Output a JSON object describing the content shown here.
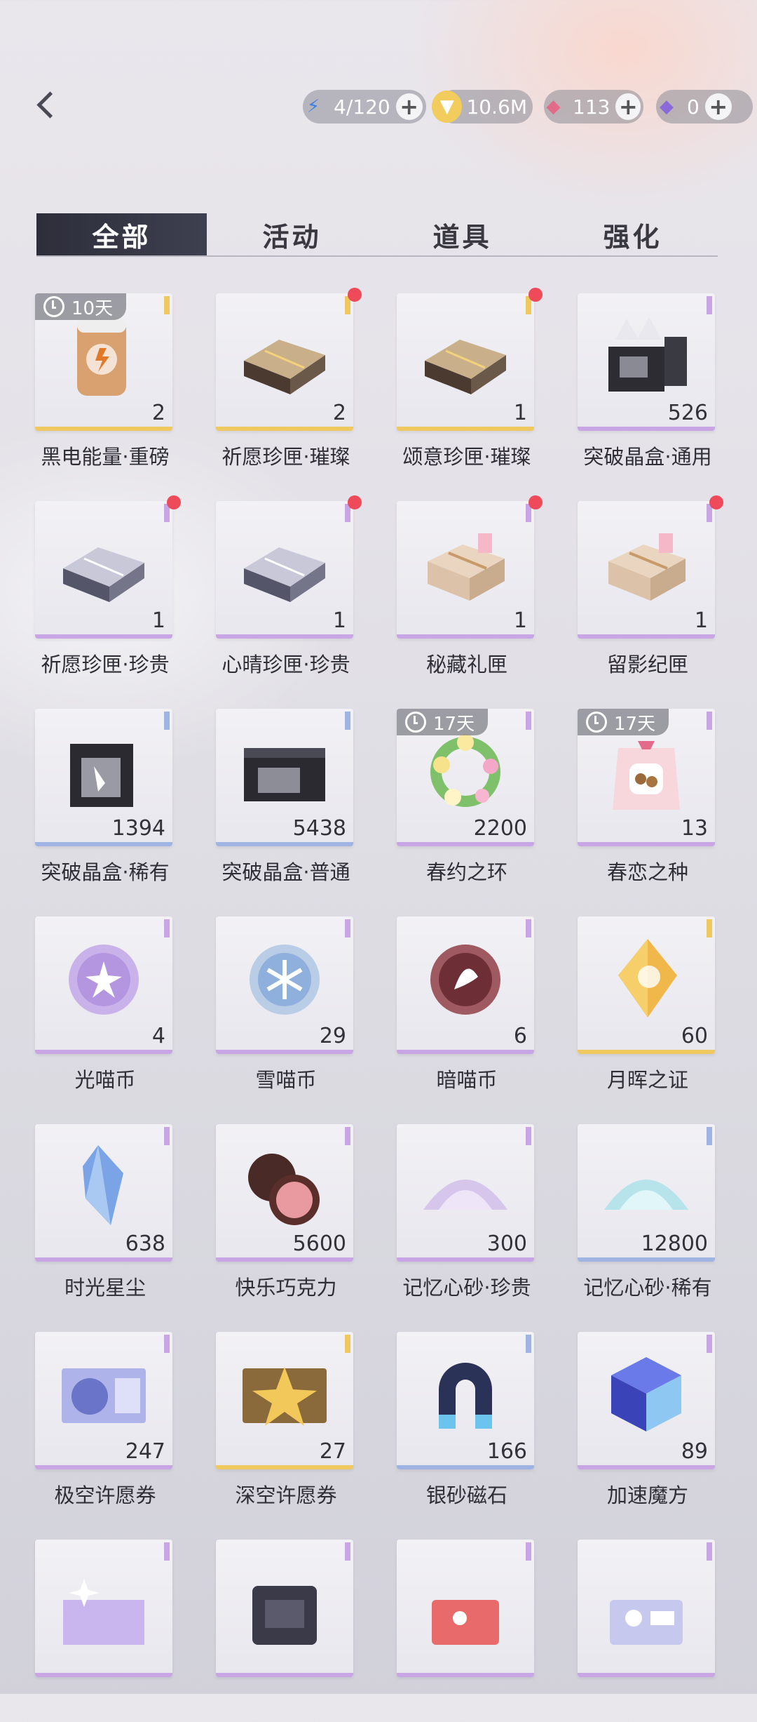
{
  "header": {
    "back_label": "",
    "resources": [
      {
        "icon": "energy-icon",
        "value": "4/120",
        "plus": "+"
      },
      {
        "icon": "gold-coin-icon",
        "value": "10.6M",
        "plus": ""
      },
      {
        "icon": "red-diamond-icon",
        "value": "113",
        "plus": "+"
      },
      {
        "icon": "purple-diamond-icon",
        "value": "0",
        "plus": "+"
      }
    ]
  },
  "tabs": [
    {
      "label": "全部",
      "active": true
    },
    {
      "label": "活动",
      "active": false
    },
    {
      "label": "道具",
      "active": false
    },
    {
      "label": "强化",
      "active": false
    }
  ],
  "colors": {
    "purple_bar": "#c8a6e6",
    "gold_bar": "#f0c860",
    "blue_bar": "#9fb4e2",
    "badge_red": "#ee4a5a"
  },
  "items": [
    {
      "name": "黑电能量·重磅",
      "qty": "2",
      "timer": "10天",
      "rarity": "gold",
      "icon": "energy-drink-can-icon"
    },
    {
      "name": "祈愿珍匣·璀璨",
      "qty": "2",
      "rarity": "gold",
      "icon": "gold-box-icon",
      "dot": true
    },
    {
      "name": "颂意珍匣·璀璨",
      "qty": "1",
      "rarity": "gold",
      "icon": "gold-box-icon",
      "dot": true
    },
    {
      "name": "突破晶盒·通用",
      "qty": "526",
      "rarity": "purple",
      "icon": "crystal-box-icon"
    },
    {
      "name": "祈愿珍匣·珍贵",
      "qty": "1",
      "rarity": "purple",
      "icon": "silver-box-icon",
      "dot": true
    },
    {
      "name": "心晴珍匣·珍贵",
      "qty": "1",
      "rarity": "purple",
      "icon": "silver-box-icon",
      "dot": true
    },
    {
      "name": "秘藏礼匣",
      "qty": "1",
      "rarity": "purple",
      "icon": "gift-box-icon",
      "dot": true
    },
    {
      "name": "留影纪匣",
      "qty": "1",
      "rarity": "purple",
      "icon": "gift-box-icon",
      "dot": true
    },
    {
      "name": "突破晶盒·稀有",
      "qty": "1394",
      "rarity": "blue",
      "icon": "black-crystal-box-icon"
    },
    {
      "name": "突破晶盒·普通",
      "qty": "5438",
      "rarity": "blue",
      "icon": "black-box-icon"
    },
    {
      "name": "春约之环",
      "qty": "2200",
      "timer": "17天",
      "rarity": "purple",
      "icon": "flower-wreath-icon"
    },
    {
      "name": "春恋之种",
      "qty": "13",
      "timer": "17天",
      "rarity": "purple",
      "icon": "seed-bag-icon"
    },
    {
      "name": "光喵币",
      "qty": "4",
      "rarity": "purple",
      "icon": "light-coin-icon"
    },
    {
      "name": "雪喵币",
      "qty": "29",
      "rarity": "purple",
      "icon": "snow-coin-icon"
    },
    {
      "name": "暗喵币",
      "qty": "6",
      "rarity": "purple",
      "icon": "dark-coin-icon"
    },
    {
      "name": "月晖之证",
      "qty": "60",
      "rarity": "gold",
      "icon": "moon-crystal-icon"
    },
    {
      "name": "时光星尘",
      "qty": "638",
      "rarity": "purple",
      "icon": "blue-crystal-icon"
    },
    {
      "name": "快乐巧克力",
      "qty": "5600",
      "rarity": "purple",
      "icon": "chocolate-icon"
    },
    {
      "name": "记忆心砂·珍贵",
      "qty": "300",
      "rarity": "purple",
      "icon": "purple-sand-icon"
    },
    {
      "name": "记忆心砂·稀有",
      "qty": "12800",
      "rarity": "blue",
      "icon": "blue-sand-icon"
    },
    {
      "name": "极空许愿券",
      "qty": "247",
      "rarity": "purple",
      "icon": "wish-ticket-icon"
    },
    {
      "name": "深空许愿券",
      "qty": "27",
      "rarity": "gold",
      "icon": "gold-ticket-icon"
    },
    {
      "name": "银砂磁石",
      "qty": "166",
      "rarity": "blue",
      "icon": "magnet-icon"
    },
    {
      "name": "加速魔方",
      "qty": "89",
      "rarity": "purple",
      "icon": "cube-icon"
    },
    {
      "name": "",
      "qty": "",
      "rarity": "purple",
      "icon": "holo-card-icon"
    },
    {
      "name": "",
      "qty": "",
      "rarity": "purple",
      "icon": "tablet-icon"
    },
    {
      "name": "",
      "qty": "",
      "rarity": "purple",
      "icon": "red-card-icon"
    },
    {
      "name": "",
      "qty": "",
      "rarity": "purple",
      "icon": "photo-card-icon"
    }
  ]
}
